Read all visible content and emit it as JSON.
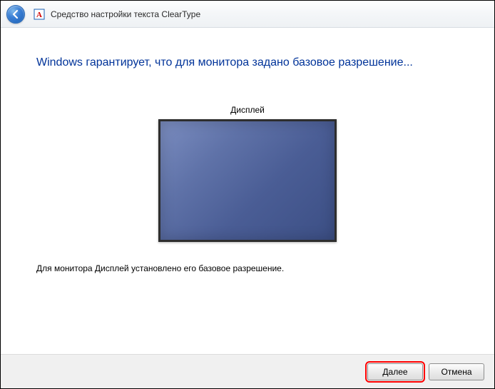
{
  "titlebar": {
    "title": "Средство настройки текста ClearType"
  },
  "main": {
    "heading": "Windows гарантирует, что для монитора задано базовое разрешение...",
    "display_label": "Дисплей",
    "status_text": "Для монитора Дисплей установлено его базовое разрешение."
  },
  "footer": {
    "next_label": "Далее",
    "cancel_label": "Отмена"
  }
}
